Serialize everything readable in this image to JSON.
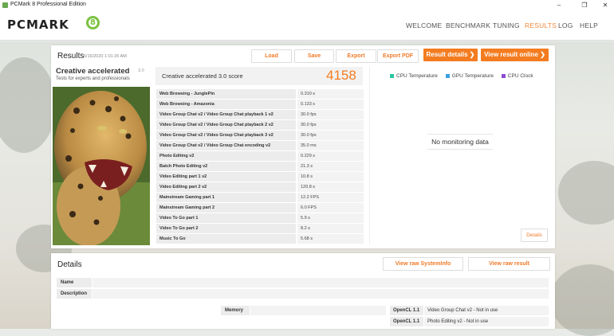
{
  "window": {
    "title": "PCMark 8 Professional Edition",
    "min": "–",
    "max": "❐",
    "close": "✕"
  },
  "header": {
    "logo_text": "PCMARK",
    "logo_num": "8",
    "nav": [
      {
        "label": "WELCOME"
      },
      {
        "label": "BENCHMARK"
      },
      {
        "label": "TUNING"
      },
      {
        "label": "RESULTS"
      },
      {
        "label": "LOG"
      },
      {
        "label": "HELP"
      }
    ]
  },
  "results": {
    "title": "Results",
    "date": "6/16/2020 1:01:26 AM",
    "buttons": {
      "load": "Load",
      "save": "Save",
      "export": "Export",
      "export_pdf": "Export PDF",
      "result_details": "Result details ❯",
      "view_online": "View result online ❯"
    },
    "test_name": "Creative accelerated",
    "test_version": "3.0",
    "test_desc": "Tests for experts and professionals",
    "score_label": "Creative accelerated 3.0 score",
    "score": "4158",
    "rows": [
      {
        "label": "Web Browsing - JunglePin",
        "value": "0.310 s"
      },
      {
        "label": "Web Browsing - Amazonia",
        "value": "0.133 s"
      },
      {
        "label": "Video Group Chat v2 / Video Group Chat playback 1 v2",
        "value": "30.0 fps"
      },
      {
        "label": "Video Group Chat v2 / Video Group Chat playback 2 v2",
        "value": "30.0 fps"
      },
      {
        "label": "Video Group Chat v2 / Video Group Chat playback 3 v2",
        "value": "30.0 fps"
      },
      {
        "label": "Video Group Chat v2 / Video Group Chat encoding v2",
        "value": "35.0 ms"
      },
      {
        "label": "Photo Editing v2",
        "value": "0.229 s"
      },
      {
        "label": "Batch Photo Editing v2",
        "value": "21.3 s"
      },
      {
        "label": "Video Editing part 1 v2",
        "value": "10.8 s"
      },
      {
        "label": "Video Editing part 2 v2",
        "value": "120.8 s"
      },
      {
        "label": "Mainstream Gaming part 1",
        "value": "12.2 FPS"
      },
      {
        "label": "Mainstream Gaming part 2",
        "value": "6.0 FPS"
      },
      {
        "label": "Video To Go part 1",
        "value": "5.9 s"
      },
      {
        "label": "Video To Go part 2",
        "value": "8.2 s"
      },
      {
        "label": "Music To Go",
        "value": "5.68 s"
      }
    ],
    "legend": [
      {
        "label": "CPU Temperature",
        "color": "#2ec4a0"
      },
      {
        "label": "GPU Temperature",
        "color": "#3aa0e0"
      },
      {
        "label": "CPU Clock",
        "color": "#8a4bd0"
      }
    ],
    "no_monitoring": "No monitoring data",
    "details_button": "Details"
  },
  "details": {
    "title": "Details",
    "view_sysinfo": "View raw SystemInfo",
    "view_result": "View raw result",
    "name_label": "Name",
    "description_label": "Description",
    "memory_label": "Memory",
    "opencl": [
      {
        "version": "OpenCL 1.1",
        "text": "Video Group Chat v2 - Not in use"
      },
      {
        "version": "OpenCL 1.1",
        "text": "Photo Editing v2 - Not in use"
      }
    ]
  }
}
